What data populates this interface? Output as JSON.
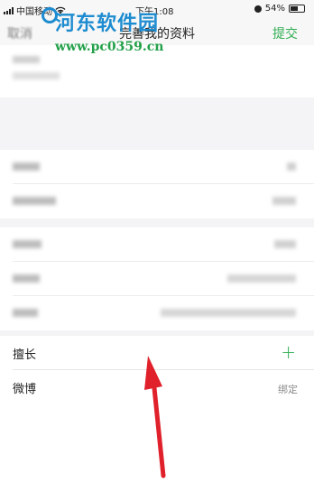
{
  "status_bar": {
    "carrier": "中国移动",
    "time": "下午1:08",
    "battery_text": "54%",
    "battery_level": 0.54
  },
  "nav": {
    "cancel_label": "取消",
    "title": "完善我的资料",
    "submit_label": "提交"
  },
  "watermark": {
    "site_name": "河东软件园",
    "url": "www.pc0359.cn"
  },
  "list": {
    "items": [
      {
        "label": "擅长",
        "action": "+"
      },
      {
        "label": "微博",
        "action": "绑定"
      }
    ]
  },
  "colors": {
    "accent": "#2fae51",
    "annotation_arrow": "#e0202a",
    "watermark_blue": "#1e8cd0"
  }
}
